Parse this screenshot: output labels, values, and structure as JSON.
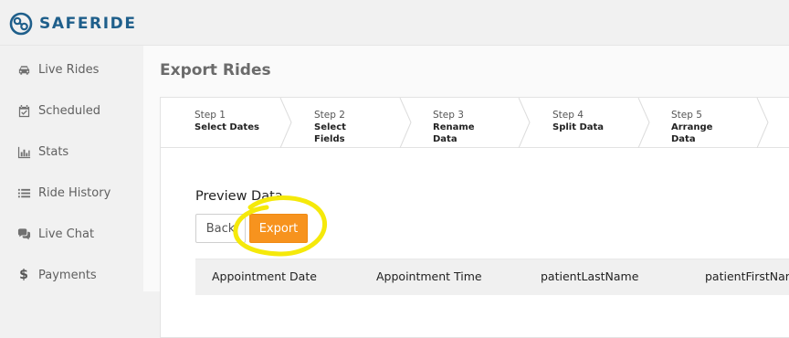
{
  "brand": {
    "name": "SAFERIDE",
    "color": "#1f5f8b"
  },
  "sidebar": {
    "items": [
      {
        "label": "Live Rides",
        "icon": "car-icon"
      },
      {
        "label": "Scheduled",
        "icon": "calendar-check-icon"
      },
      {
        "label": "Stats",
        "icon": "bar-chart-icon"
      },
      {
        "label": "Ride History",
        "icon": "list-icon"
      },
      {
        "label": "Live Chat",
        "icon": "chat-bubbles-icon"
      },
      {
        "label": "Payments",
        "icon": "dollar-icon"
      }
    ]
  },
  "main": {
    "title": "Export Rides",
    "steps": [
      {
        "num": "Step 1",
        "name": "Select Dates"
      },
      {
        "num": "Step 2",
        "name": "Select\nFields"
      },
      {
        "num": "Step 3",
        "name": "Rename\nData"
      },
      {
        "num": "Step 4",
        "name": "Split Data"
      },
      {
        "num": "Step 5",
        "name": "Arrange\nData"
      }
    ],
    "preview_title": "Preview Data",
    "back_label": "Back",
    "export_label": "Export",
    "table": {
      "columns": [
        "Appointment Date",
        "Appointment Time",
        "patientLastName",
        "patientFirstName"
      ]
    }
  },
  "colors": {
    "accent": "#f7931e",
    "highlight": "#f5e90a"
  }
}
